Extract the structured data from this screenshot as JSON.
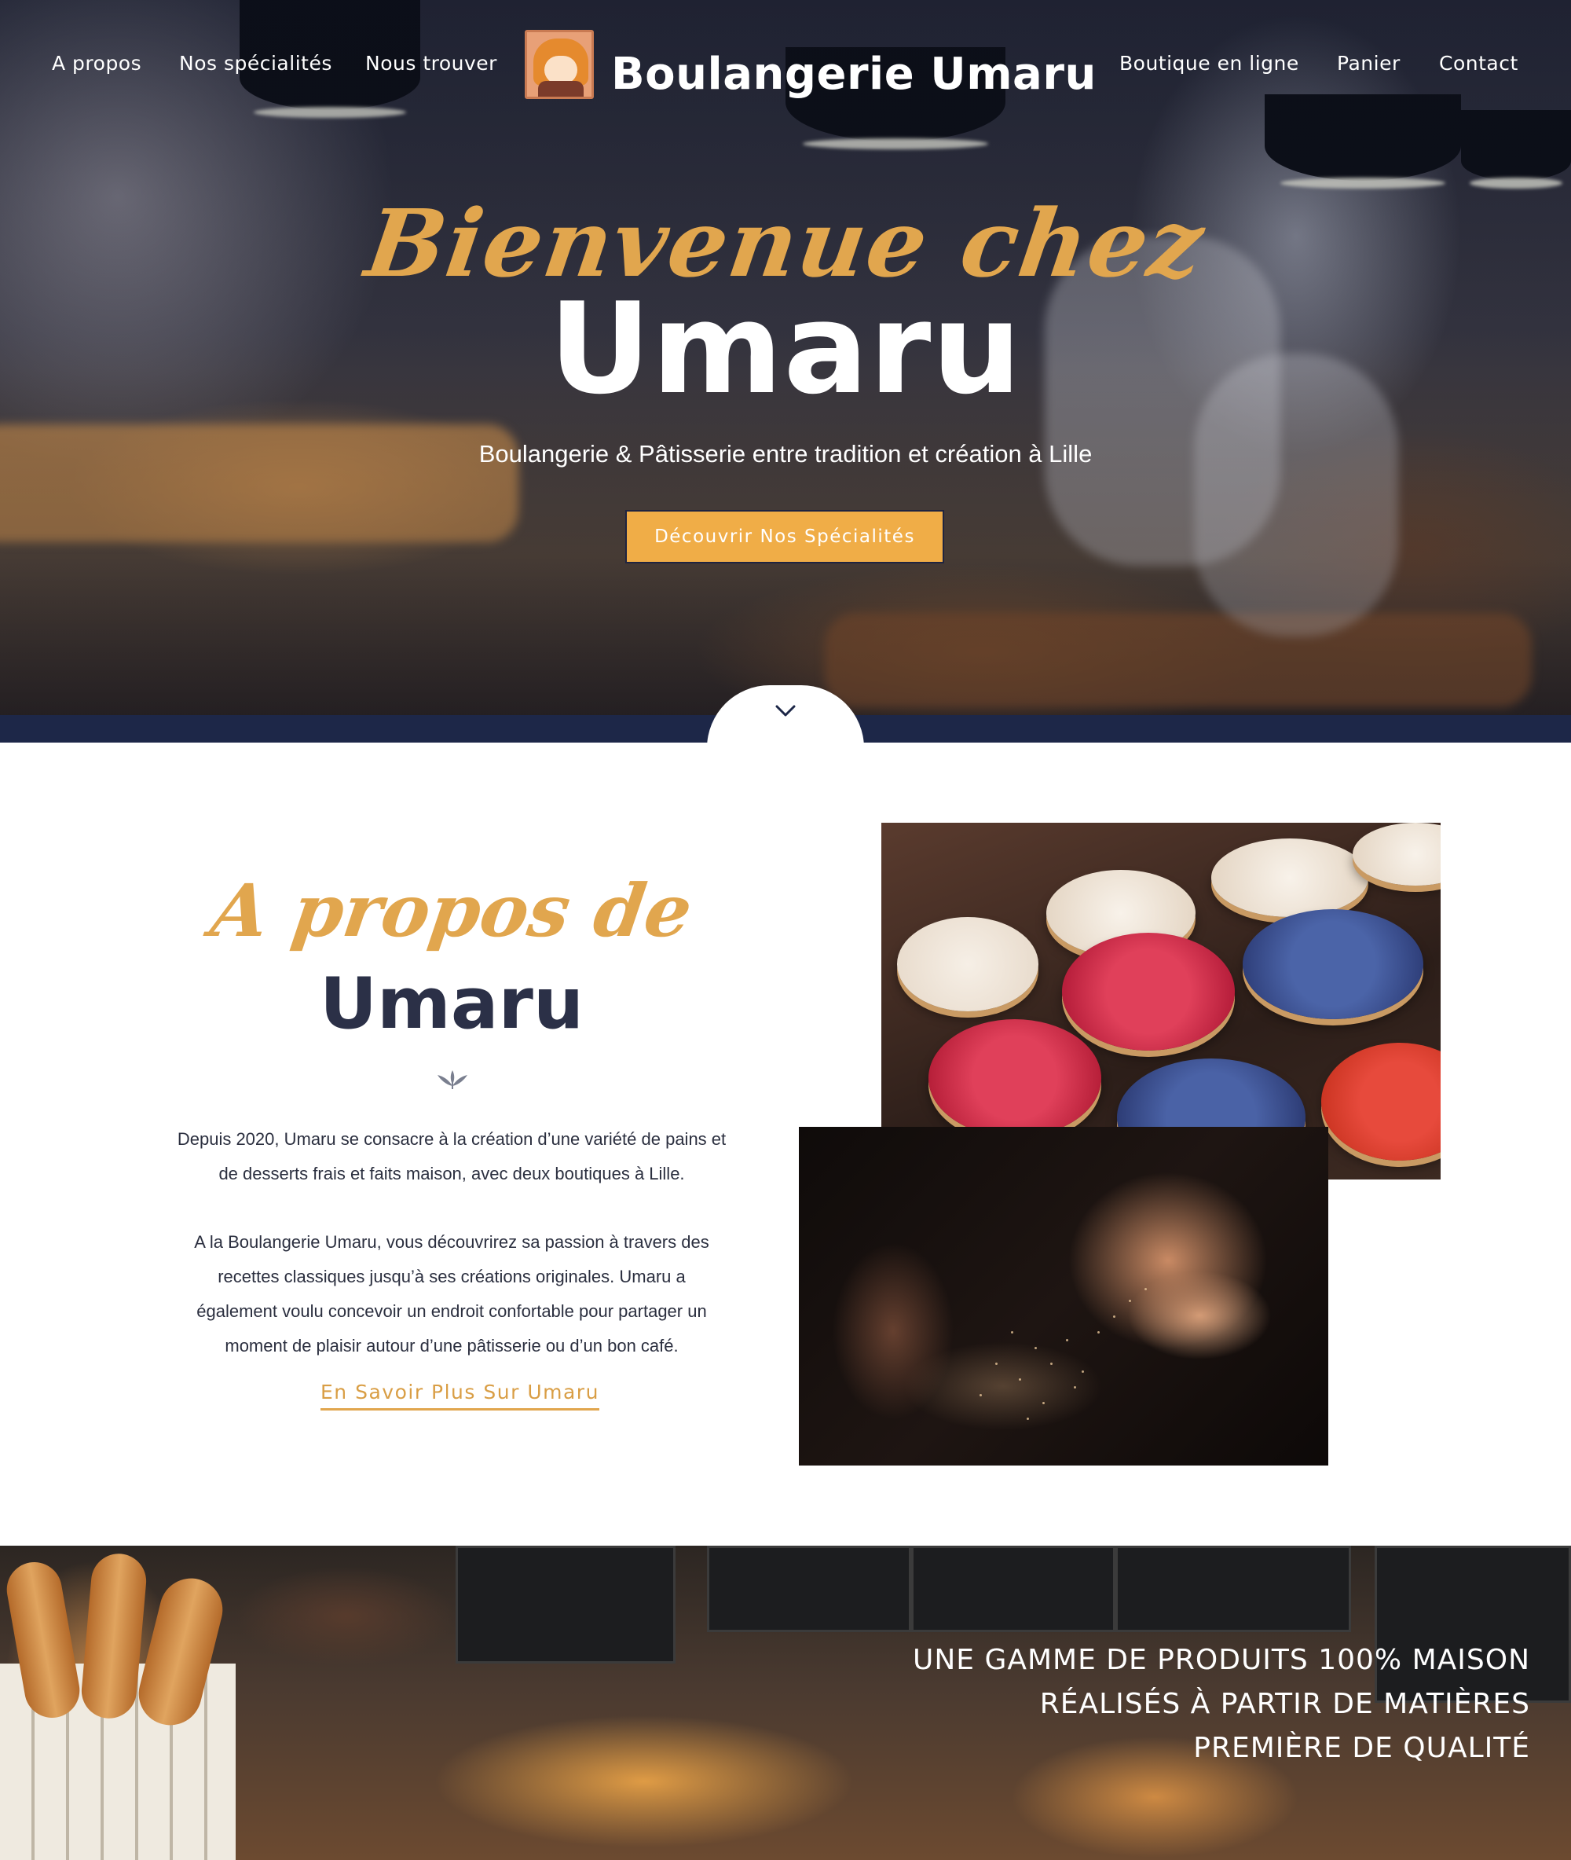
{
  "nav": {
    "left": [
      "A propos",
      "Nos spécialités",
      "Nous trouver"
    ],
    "right": [
      "Boutique en ligne",
      "Panier",
      "Contact"
    ],
    "brand": "Boulangerie Umaru"
  },
  "hero": {
    "script": "Bienvenue chez",
    "title": "Umaru",
    "subtitle": "Boulangerie & Pâtisserie entre tradition et création à Lille",
    "button": "Découvrir Nos Spécialités",
    "scroll_icon": "chevron-down-icon"
  },
  "about": {
    "script": "A propos de",
    "title": "Umaru",
    "paragraph1": "Depuis 2020, Umaru se consacre à la création d’une variété de pains et de desserts frais et faits maison, avec deux boutiques à Lille.",
    "paragraph2": "A la Boulangerie Umaru, vous découvrirez sa passion à travers des recettes classiques jusqu’à ses créations originales. Umaru a également voulu concevoir un endroit confortable pour partager un moment de plaisir autour d’une pâtisserie ou d’un bon café.",
    "link": "En Savoir Plus Sur Umaru"
  },
  "banner": {
    "lines": [
      "UNE GAMME DE PRODUITS 100% MAISON",
      "RÉALISÉS À PARTIR DE MATIÈRES",
      "PREMIÈRE DE QUALITÉ"
    ]
  },
  "colors": {
    "accent": "#f0ad47",
    "gold_text": "#e1a64e",
    "navy": "#1d2748",
    "dark_text": "#2b3047"
  }
}
